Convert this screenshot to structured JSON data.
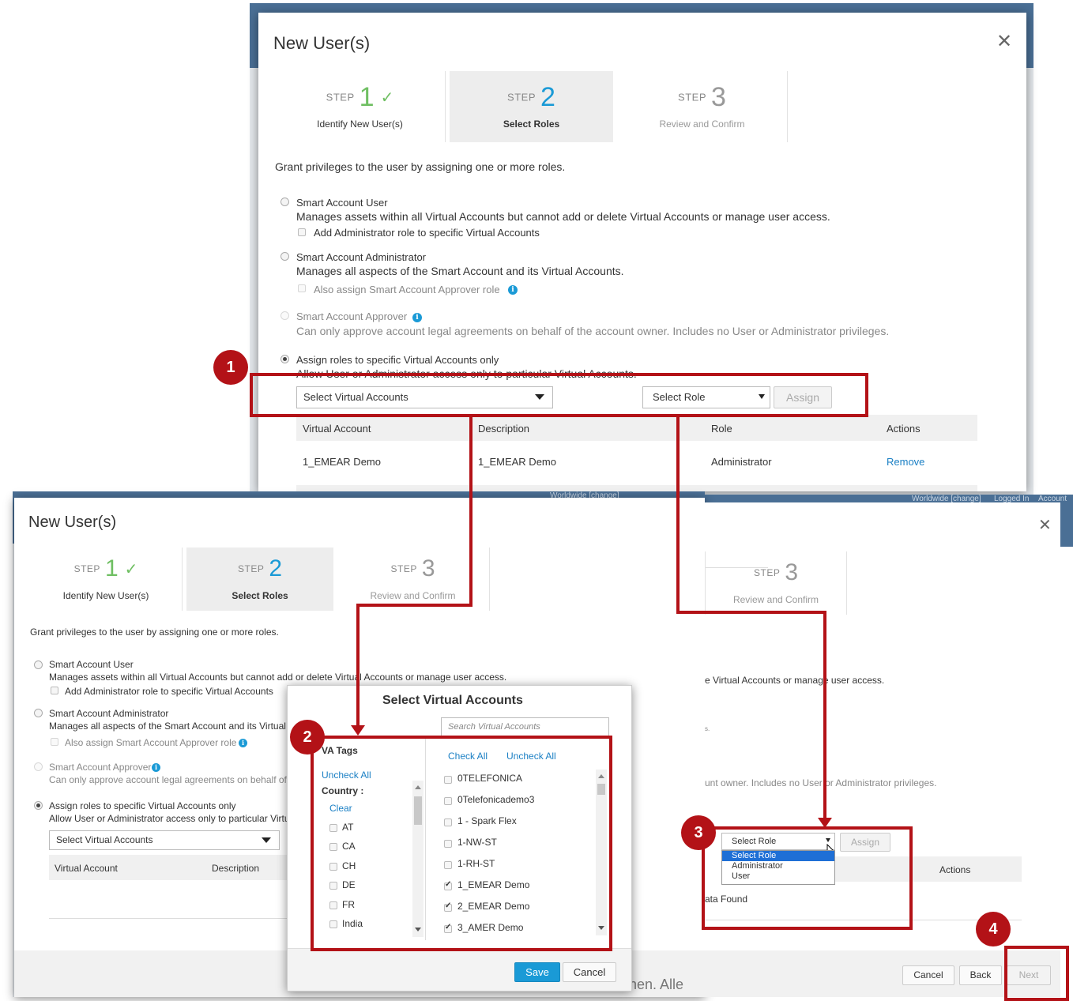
{
  "modal_top": {
    "title": "New User(s)",
    "header_links": [
      "Worldwide [change]",
      "Logged In",
      "Account"
    ],
    "steps": [
      {
        "word": "STEP",
        "num": "1",
        "caption": "Identify New User(s)"
      },
      {
        "word": "STEP",
        "num": "2",
        "caption": "Select Roles"
      },
      {
        "word": "STEP",
        "num": "3",
        "caption": "Review and Confirm"
      }
    ],
    "intro": "Grant privileges to the user by assigning one or more roles.",
    "options": [
      {
        "label": "Smart Account User",
        "desc": "Manages assets within all Virtual Accounts but cannot add or delete Virtual Accounts or manage user access.",
        "sub": "Add Administrator role to specific Virtual Accounts"
      },
      {
        "label": "Smart Account Administrator",
        "desc": "Manages all aspects of the Smart Account and its Virtual Accounts.",
        "sub": "Also assign Smart Account Approver role"
      },
      {
        "label": "Smart Account Approver",
        "desc": "Can only approve account legal agreements on behalf of the account owner. Includes no User or Administrator privileges."
      },
      {
        "label": "Assign roles to specific Virtual Accounts only",
        "desc": "Allow User or Administrator access only to particular Virtual Accounts."
      }
    ],
    "select_va": "Select Virtual Accounts",
    "select_role": "Select Role",
    "assign": "Assign",
    "table": {
      "headers": [
        "Virtual Account",
        "Description",
        "Role",
        "Actions"
      ],
      "rows": [
        [
          "1_EMEAR Demo",
          "1_EMEAR Demo",
          "Administrator",
          "Remove"
        ]
      ]
    }
  },
  "modal_left": {
    "title": "New User(s)",
    "header_links": [
      "Worldwide [change]"
    ],
    "steps": [
      {
        "word": "STEP",
        "num": "1",
        "caption": "Identify New User(s)"
      },
      {
        "word": "STEP",
        "num": "2",
        "caption": "Select Roles"
      },
      {
        "word": "STEP",
        "num": "3",
        "caption": "Review and Confirm"
      }
    ],
    "intro": "Grant privileges to the user by assigning one or more roles.",
    "options": [
      {
        "label": "Smart Account User",
        "desc": "Manages assets within all Virtual Accounts but cannot add or delete Virtual Accounts or manage user access.",
        "sub": "Add Administrator role to specific Virtual Accounts"
      },
      {
        "label": "Smart Account Administrator",
        "desc": "Manages all aspects of the Smart Account and its Virtual Accounts.",
        "sub": "Also assign Smart Account Approver role"
      },
      {
        "label": "Smart Account Approver",
        "desc": "Can only approve account legal agreements on behalf of the account owner."
      },
      {
        "label": "Assign roles to specific Virtual Accounts only",
        "desc": "Allow User or Administrator access only to particular Virtual Accounts."
      }
    ],
    "select_va": "Select Virtual Accounts",
    "table_headers": [
      "Virtual Account",
      "Description"
    ],
    "footer_text": "hen. Alle"
  },
  "popup": {
    "title": "Select Virtual Accounts",
    "search_placeholder": "Search Virtual Accounts",
    "va_tags": "VA Tags",
    "uncheck_all": "Uncheck All",
    "country": "Country :",
    "clear": "Clear",
    "countries": [
      "AT",
      "CA",
      "CH",
      "DE",
      "FR",
      "India"
    ],
    "check_all": "Check All",
    "uncheck_all_right": "Uncheck All",
    "accounts": [
      {
        "name": "0TELEFONICA",
        "checked": false
      },
      {
        "name": "0Telefonicademo3",
        "checked": false
      },
      {
        "name": "1 - Spark Flex",
        "checked": false
      },
      {
        "name": "1-NW-ST",
        "checked": false
      },
      {
        "name": "1-RH-ST",
        "checked": false
      },
      {
        "name": "1_EMEAR Demo",
        "checked": true
      },
      {
        "name": "2_EMEAR Demo",
        "checked": true
      },
      {
        "name": "3_AMER Demo",
        "checked": true
      }
    ],
    "save": "Save",
    "cancel": "Cancel"
  },
  "modal_right": {
    "header_links": [
      "Worldwide [change]",
      "Logged In",
      "Account"
    ],
    "step3": {
      "word": "STEP",
      "num": "3",
      "caption": "Review and Confirm"
    },
    "frag1": "e Virtual Accounts or manage user access.",
    "frag2": "unt owner. Includes no User or Administrator privileges.",
    "frag3": "s.",
    "select_role": "Select Role",
    "role_options": [
      "Select Role",
      "Administrator",
      "User"
    ],
    "assign": "Assign",
    "actions": "Actions",
    "no_data": "ata Found",
    "cancel": "Cancel",
    "back": "Back",
    "next": "Next"
  },
  "badges": [
    "1",
    "2",
    "3",
    "4"
  ],
  "colors": {
    "callout": "#b31217",
    "accent": "#1a9ad6",
    "check": "#6fbf62"
  }
}
